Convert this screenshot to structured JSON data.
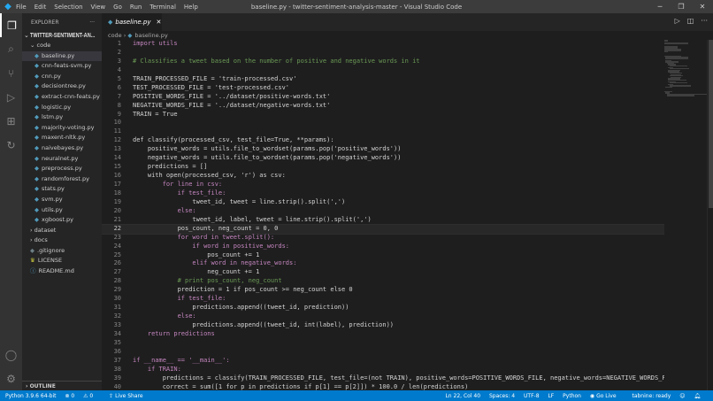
{
  "titlebar": {
    "menu": [
      "File",
      "Edit",
      "Selection",
      "View",
      "Go",
      "Run",
      "Terminal",
      "Help"
    ],
    "title": "baseline.py - twitter-sentiment-analysis-master - Visual Studio Code"
  },
  "sidebar": {
    "header": "EXPLORER",
    "project": "TWITTER-SENTIMENT-AN...",
    "folder": "code",
    "files": [
      "baseline.py",
      "cnn-feats-svm.py",
      "cnn.py",
      "decisiontree.py",
      "extract-cnn-feats.py",
      "logistic.py",
      "lstm.py",
      "majority-voting.py",
      "maxent-nltk.py",
      "naivebayes.py",
      "neuralnet.py",
      "preprocess.py",
      "randomforest.py",
      "stats.py",
      "svm.py",
      "utils.py",
      "xgboost.py"
    ],
    "folders": [
      "dataset",
      "docs"
    ],
    "others": [
      ".gitignore",
      "LICENSE",
      "README.md"
    ],
    "outline": "OUTLINE"
  },
  "tab": {
    "label": "baseline.py"
  },
  "breadcrumb": {
    "folder": "code",
    "file": "baseline.py"
  },
  "code": [
    "import utils",
    "",
    "# Classifies a tweet based on the number of positive and negative words in it",
    "",
    "TRAIN_PROCESSED_FILE = 'train-processed.csv'",
    "TEST_PROCESSED_FILE = 'test-processed.csv'",
    "POSITIVE_WORDS_FILE = '../dataset/positive-words.txt'",
    "NEGATIVE_WORDS_FILE = '../dataset/negative-words.txt'",
    "TRAIN = True",
    "",
    "",
    "def classify(processed_csv, test_file=True, **params):",
    "    positive_words = utils.file_to_wordset(params.pop('positive_words'))",
    "    negative_words = utils.file_to_wordset(params.pop('negative_words'))",
    "    predictions = []",
    "    with open(processed_csv, 'r') as csv:",
    "        for line in csv:",
    "            if test_file:",
    "                tweet_id, tweet = line.strip().split(',')",
    "            else:",
    "                tweet_id, label, tweet = line.strip().split(',')",
    "            pos_count, neg_count = 0, 0",
    "            for word in tweet.split():",
    "                if word in positive_words:",
    "                    pos_count += 1",
    "                elif word in negative_words:",
    "                    neg_count += 1",
    "            # print pos_count, neg_count",
    "            prediction = 1 if pos_count >= neg_count else 0",
    "            if test_file:",
    "                predictions.append((tweet_id, prediction))",
    "            else:",
    "                predictions.append((tweet_id, int(label), prediction))",
    "    return predictions",
    "",
    "",
    "if __name__ == '__main__':",
    "    if TRAIN:",
    "        predictions = classify(TRAIN_PROCESSED_FILE, test_file=(not TRAIN), positive_words=POSITIVE_WORDS_FILE, negative_words=NEGATIVE_WORDS_FILE)",
    "        correct = sum([1 for p in predictions if p[1] == p[2]]) * 100.0 / len(predictions)"
  ],
  "current_line": 22,
  "status": {
    "python": "Python 3.9.6 64-bit",
    "errors": "0",
    "warnings": "0",
    "liveshare": "Live Share",
    "position": "Ln 22, Col 40",
    "spaces": "Spaces: 4",
    "encoding": "UTF-8",
    "eol": "LF",
    "language": "Python",
    "golive": "Go Live",
    "tabnine": "tabnine: ready"
  }
}
